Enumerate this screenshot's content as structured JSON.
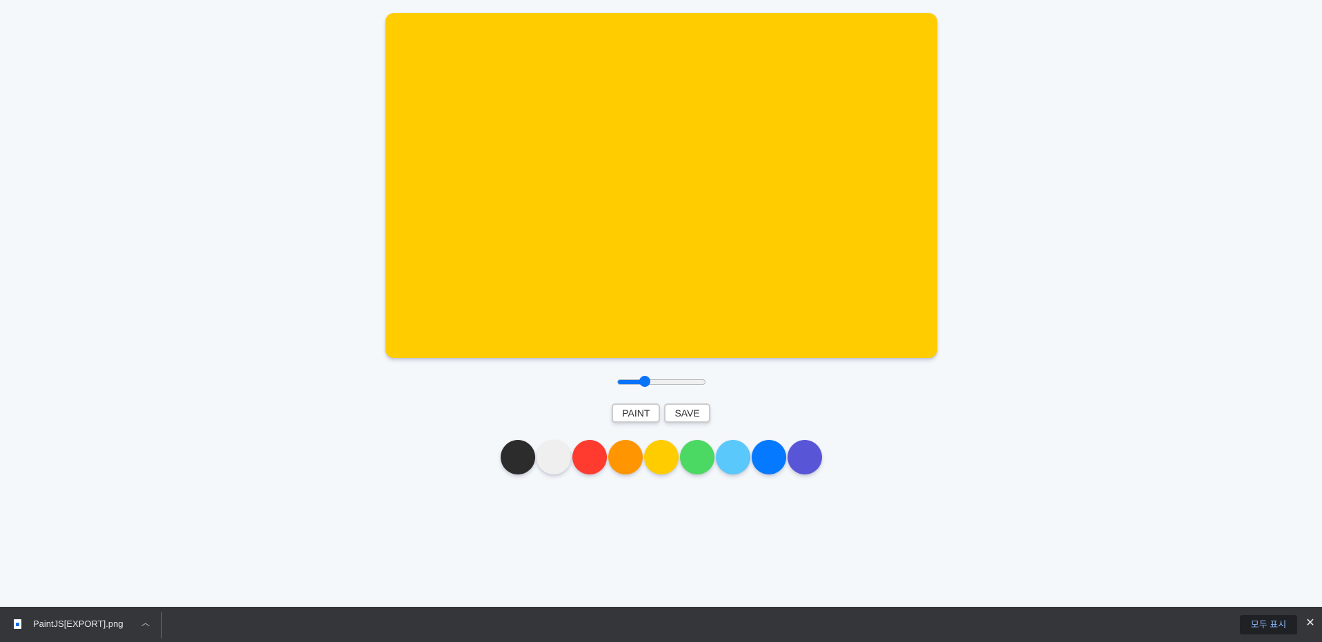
{
  "canvas": {
    "fill_color": "#ffcc00"
  },
  "brush_range": {
    "value_fraction": 0.29,
    "accent_color": "#0a74f9"
  },
  "buttons": {
    "mode_label": "Paint",
    "save_label": "Save"
  },
  "palette": {
    "colors": [
      "#2c2c2c",
      "#efefef",
      "#ff3b30",
      "#ff9500",
      "#ffcc00",
      "#4cd963",
      "#5ac8fa",
      "#0579ff",
      "#5856d6"
    ]
  },
  "download_bar": {
    "file_name": "PaintJS[EXPORT].png",
    "file_icon": "file-image-icon",
    "expand_icon": "chevron-up-icon",
    "show_all_label": "모두 표시",
    "close_icon": "close-icon"
  }
}
